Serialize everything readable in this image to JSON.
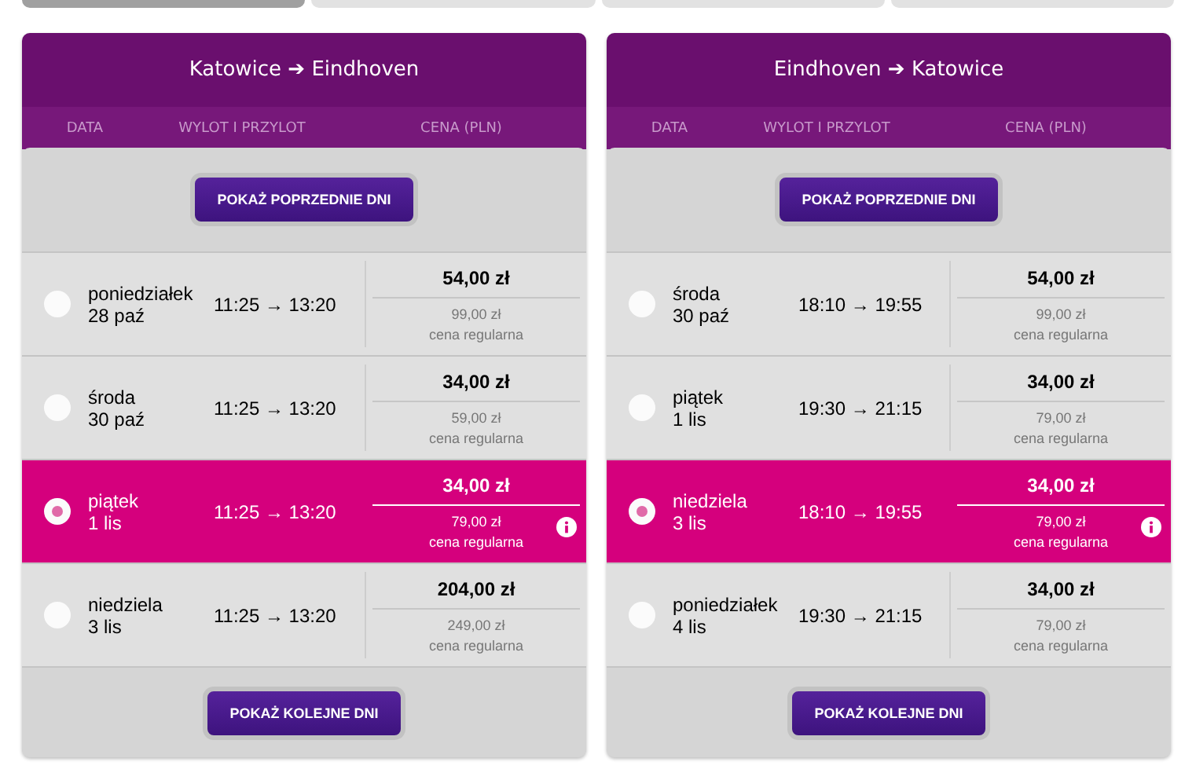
{
  "steps": [
    {
      "selected": true
    },
    {
      "selected": false
    },
    {
      "selected": false
    },
    {
      "selected": false
    }
  ],
  "panels": [
    {
      "title": "Katowice ➔ Eindhoven",
      "columns": [
        "DATA",
        "WYLOT I PRZYLOT",
        "CENA (PLN)"
      ],
      "prev_button": "POKAŻ POPRZEDNIE DNI",
      "next_button": "POKAŻ KOLEJNE DNI",
      "rows": [
        {
          "day": "poniedziałek",
          "date": "28 paź",
          "times": "11:25 → 13:20",
          "price": "54,00 zł",
          "regular_price": "99,00 zł",
          "regular_label": "cena regularna",
          "selected": false
        },
        {
          "day": "środa",
          "date": "30 paź",
          "times": "11:25 → 13:20",
          "price": "34,00 zł",
          "regular_price": "59,00 zł",
          "regular_label": "cena regularna",
          "selected": false
        },
        {
          "day": "piątek",
          "date": "1 lis",
          "times": "11:25 → 13:20",
          "price": "34,00 zł",
          "regular_price": "79,00 zł",
          "regular_label": "cena regularna",
          "selected": true
        },
        {
          "day": "niedziela",
          "date": "3 lis",
          "times": "11:25 → 13:20",
          "price": "204,00 zł",
          "regular_price": "249,00 zł",
          "regular_label": "cena regularna",
          "selected": false
        }
      ]
    },
    {
      "title": "Eindhoven ➔ Katowice",
      "columns": [
        "DATA",
        "WYLOT I PRZYLOT",
        "CENA (PLN)"
      ],
      "prev_button": "POKAŻ POPRZEDNIE DNI",
      "next_button": "POKAŻ KOLEJNE DNI",
      "rows": [
        {
          "day": "środa",
          "date": "30 paź",
          "times": "18:10 → 19:55",
          "price": "54,00 zł",
          "regular_price": "99,00 zł",
          "regular_label": "cena regularna",
          "selected": false
        },
        {
          "day": "piątek",
          "date": "1 lis",
          "times": "19:30 → 21:15",
          "price": "34,00 zł",
          "regular_price": "79,00 zł",
          "regular_label": "cena regularna",
          "selected": false
        },
        {
          "day": "niedziela",
          "date": "3 lis",
          "times": "18:10 → 19:55",
          "price": "34,00 zł",
          "regular_price": "79,00 zł",
          "regular_label": "cena regularna",
          "selected": true
        },
        {
          "day": "poniedziałek",
          "date": "4 lis",
          "times": "19:30 → 21:15",
          "price": "34,00 zł",
          "regular_price": "79,00 zł",
          "regular_label": "cena regularna",
          "selected": false
        }
      ]
    }
  ]
}
